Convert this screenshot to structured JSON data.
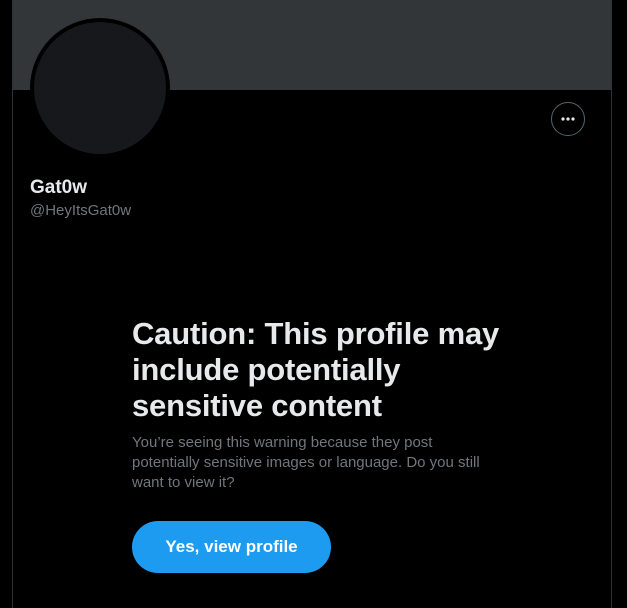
{
  "profile": {
    "display_name": "Gat0w",
    "handle": "@HeyItsGat0w"
  },
  "header": {
    "more_icon": "ellipsis-horizontal-icon"
  },
  "warning": {
    "title": "Caution: This profile may include potentially sensitive content",
    "body": "You’re seeing this warning because they post potentially sensitive images or language. Do you still want to view it?",
    "button_label": "Yes, view profile"
  },
  "colors": {
    "background": "#000000",
    "banner": "#333639",
    "primary_text": "#e7e9ea",
    "secondary_text": "#71767b",
    "accent": "#1d9bf0",
    "border": "#2f3336"
  }
}
